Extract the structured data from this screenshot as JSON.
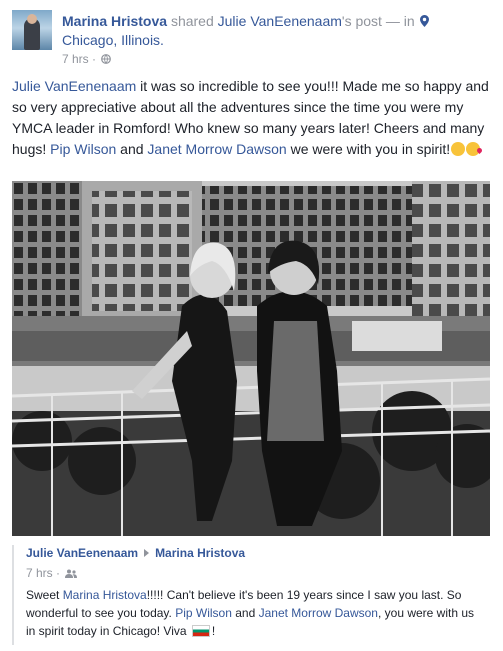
{
  "post": {
    "author": "Marina Hristova",
    "shared_word": "shared",
    "shared_from": "Julie VanEenenaam",
    "shared_suffix": "'s post — in",
    "location": "Chicago, Illinois.",
    "time": "7 hrs",
    "privacy_icon": "globe-icon",
    "text_mention_1": "Julie VanEenenaam",
    "text_body_1": " it was so incredible to see you!!! Made me so happy and so very appreciative about all the adventures since the time you were my YMCA leader in Romford! Who knew so many years later! Cheers and many hugs! ",
    "text_mention_2": "Pip Wilson",
    "text_and": " and ",
    "text_mention_3": "Janet Morrow Dawson",
    "text_body_2": " we were with you in spirit!",
    "emojis": [
      "smiling-face-emoji",
      "kissing-face-emoji"
    ]
  },
  "comment": {
    "author": "Julie VanEenenaam",
    "target": "Marina Hristova",
    "time": "7 hrs",
    "privacy_icon": "friends-icon",
    "text_1": "Sweet ",
    "mention_1": "Marina Hristova",
    "text_2": "!!!!! Can't believe it's been 19 years since I saw you last. So wonderful to see you today. ",
    "mention_2": "Pip Wilson",
    "text_3": " and ",
    "mention_3": "Janet Morrow Dawson",
    "text_4": ", you were with us in spirit today in Chicago! Viva ",
    "flag_icon": "bulgaria-flag-icon",
    "text_5": "!"
  },
  "colors": {
    "link": "#365899",
    "meta": "#90949c",
    "text": "#1d2129"
  }
}
